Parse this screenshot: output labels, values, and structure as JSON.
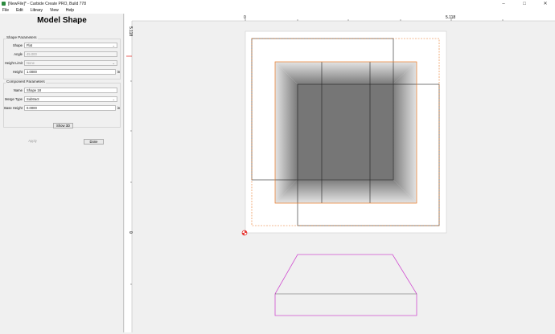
{
  "window": {
    "title": "[NewFile]* - Carbide Create PRO, Build 778",
    "minimize": "–",
    "maximize": "□",
    "close": "✕"
  },
  "menu": [
    "File",
    "Edit",
    "Library",
    "View",
    "Help"
  ],
  "panel": {
    "title": "Model Shape",
    "shape_group_label": "Shape Parameters",
    "shape_label": "Shape",
    "shape_value": "Flat",
    "angle_label": "Angle",
    "angle_value": "45.000",
    "height_limit_label": "Height Limit",
    "height_limit_value": "None",
    "height_label": "Height",
    "height_value": "1.0000",
    "height_unit": "in",
    "component_group_label": "Component Parameters",
    "name_label": "Name",
    "name_value": "Shape 18",
    "merge_label": "Merge Type",
    "merge_value": "Subtract",
    "base_height_label": "Base Height",
    "base_height_value": "0.0000",
    "base_height_unit": "in",
    "show3d_label": "Show 3D",
    "apply_label": "Apply",
    "done_label": "Done"
  },
  "rulers": {
    "top_zero": "0",
    "top_end": "5.118",
    "left_top": "5.118",
    "left_zero": "0"
  },
  "colors": {
    "outline": "#e87722",
    "profile": "#d04fd0",
    "origin": "#e53935"
  }
}
